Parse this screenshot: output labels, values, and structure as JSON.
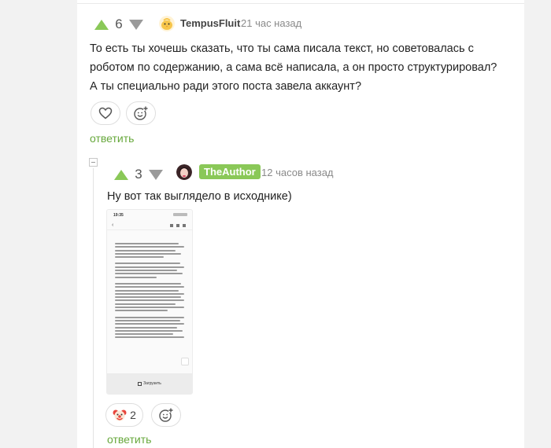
{
  "comment1": {
    "votes": "6",
    "username": "TempusFluit",
    "timestamp": "21 час назад",
    "text": "То есть ты хочешь сказать, что ты сама писала текст, но советовалась с роботом по содержанию, а сама всё написала, а он просто структурировал? А ты специально ради этого поста завела аккаунт?",
    "reply_label": "ответить"
  },
  "comment2": {
    "votes": "3",
    "username": "TheAuthor",
    "timestamp": "12 часов назад",
    "text": "Ну вот так выглядело в исходнике)",
    "reaction_count": "2",
    "reply_label": "ответить",
    "thumb": {
      "status_time": "19:35",
      "footer_label": "Загрузить"
    }
  },
  "colors": {
    "accent": "#8ac858",
    "link": "#67a83c",
    "muted": "#8a8a8a"
  },
  "icons": {
    "upvote": "triangle-up",
    "downvote": "triangle-down",
    "like": "heart-icon",
    "add_reaction": "smile-plus-icon",
    "reaction_clown": "clown-emoji"
  }
}
